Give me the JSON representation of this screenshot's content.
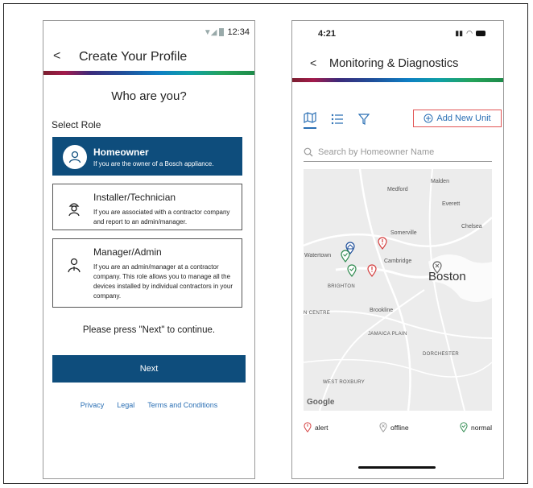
{
  "profile_screen": {
    "status": {
      "time": "12:34"
    },
    "header": {
      "back": "<",
      "title": "Create Your Profile"
    },
    "question": "Who are you?",
    "select_role_label": "Select Role",
    "roles": [
      {
        "title": "Homeowner",
        "description": "If you are the owner of a Bosch appliance.",
        "selected": true
      },
      {
        "title": "Installer/Technician",
        "description": "If you are associated with a contractor company and report to an admin/manager.",
        "selected": false
      },
      {
        "title": "Manager/Admin",
        "description": "If you are an admin/manager at a contractor company. This role allows you to manage all the devices installed by individual contractors in your company.",
        "selected": false
      }
    ],
    "instruction": "Please press \"Next\" to continue.",
    "next_label": "Next",
    "links": [
      "Privacy",
      "Legal",
      "Terms and Conditions"
    ],
    "colors": {
      "primary": "#0e4d7c",
      "link": "#2a6fb4"
    }
  },
  "monitor_screen": {
    "status": {
      "time": "4:21"
    },
    "header": {
      "back": "<",
      "title": "Monitoring & Diagnostics"
    },
    "toolbar": {
      "icons": [
        "map-icon",
        "list-icon",
        "filter-icon"
      ],
      "add_unit_label": "Add New Unit"
    },
    "search": {
      "placeholder": "Search by Homeowner Name"
    },
    "map": {
      "labels": [
        "Malden",
        "Medford",
        "Everett",
        "Somerville",
        "Chelsea",
        "Watertown",
        "Cambridge",
        "Boston",
        "BRIGHTON",
        "Brookline",
        "N CENTRE",
        "JAMAICA PLAIN",
        "DORCHESTER",
        "WEST ROXBURY"
      ],
      "attribution": "Google"
    },
    "legend": [
      {
        "label": "alert",
        "color": "#d43c3c"
      },
      {
        "label": "offline",
        "color": "#9a9a9a"
      },
      {
        "label": "normal",
        "color": "#2d8a4e"
      }
    ]
  }
}
